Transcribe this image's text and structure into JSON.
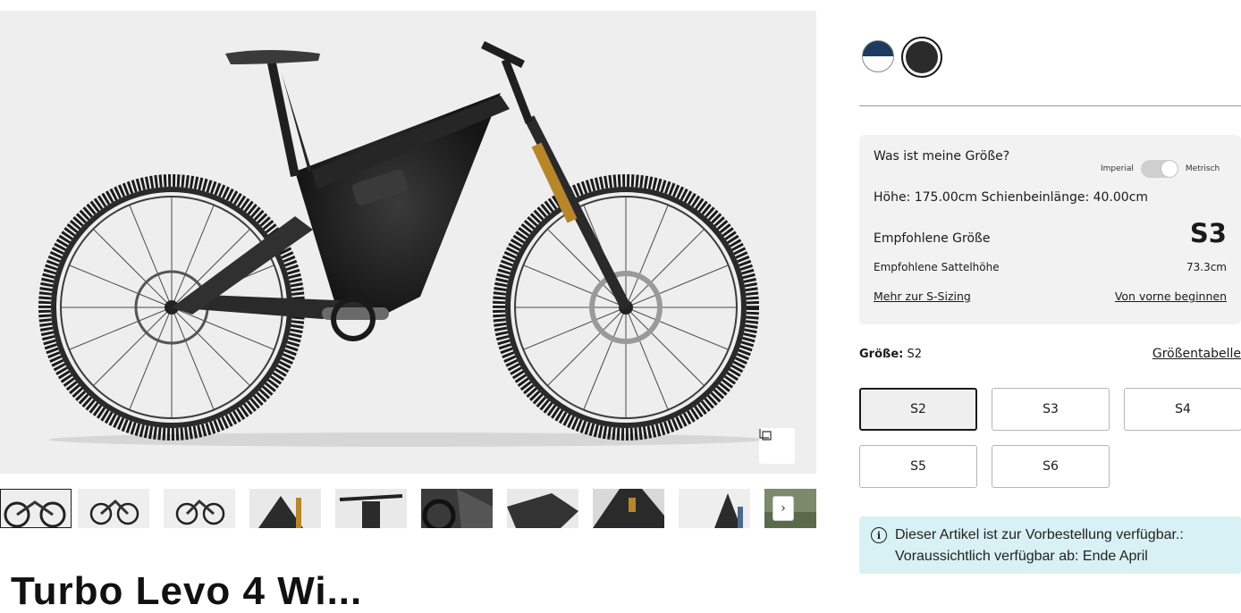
{
  "gallery": {
    "expand_icon": "expand-icon",
    "next_icon": "chevron-right-icon",
    "next_glyph": "›",
    "thumbnail_count": 10
  },
  "product": {
    "title_partial": "Turbo Levo 4 Wi..."
  },
  "colors": {
    "swatches": [
      {
        "name": "navy-white",
        "hex": "#1f3a5f"
      },
      {
        "name": "black",
        "hex": "#2b2b2b",
        "selected": true
      }
    ]
  },
  "size_finder": {
    "question": "Was ist meine Größe?",
    "unit_left": "Imperial",
    "unit_right": "Metrisch",
    "measurements": "Höhe: 175.00cm  Schienbeinlänge: 40.00cm",
    "recommended_label": "Empfohlene Größe",
    "recommended_value": "S3",
    "saddle_label": "Empfohlene Sattelhöhe",
    "saddle_value": "73.3cm",
    "more_link": "Mehr zur S-Sizing",
    "restart_link": "Von vorne beginnen"
  },
  "size_select": {
    "label": "Größe:",
    "selected": "S2",
    "chart_link": "Größentabelle",
    "options": [
      "S2",
      "S3",
      "S4",
      "S5",
      "S6"
    ]
  },
  "notice": {
    "icon": "info-icon",
    "glyph": "i",
    "text": "Dieser Artikel ist zur Vorbestellung verfügbar.: Voraussichtlich verfügbar ab: Ende April"
  },
  "theme": {
    "accent_text": "#1a1a1a",
    "notice_bg": "#d8f1f4",
    "panel_bg": "#f2f2f2"
  }
}
